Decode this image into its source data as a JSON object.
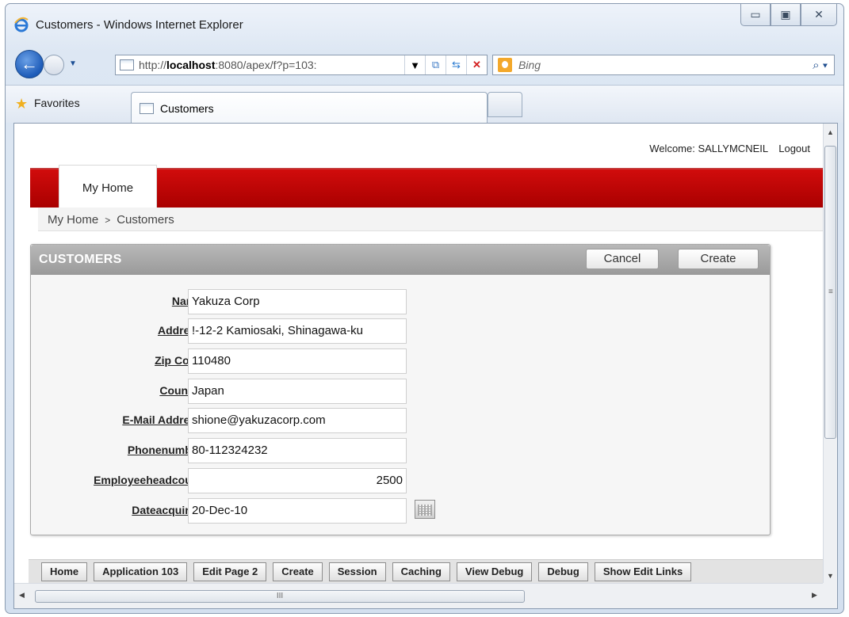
{
  "window": {
    "title": "Customers - Windows Internet Explorer",
    "controls": [
      "minimize-icon",
      "maximize-icon",
      "close-icon"
    ]
  },
  "navigation": {
    "url_prefix": "http://",
    "url_host": "localhost",
    "url_rest": ":8080/apex/f?p=103:",
    "search_placeholder": "Bing"
  },
  "favorites_bar": {
    "favorites_label": "Favorites",
    "tab_label": "Customers"
  },
  "header": {
    "welcome": "Welcome: SALLYMCNEIL",
    "logout": "Logout",
    "tab": "My Home"
  },
  "breadcrumb": {
    "items": [
      "My Home",
      "Customers"
    ],
    "separator": ">"
  },
  "region": {
    "title": "CUSTOMERS",
    "cancel_label": "Cancel",
    "create_label": "Create"
  },
  "form": {
    "fields": [
      {
        "label": "Name",
        "value": "Yakuza Corp"
      },
      {
        "label": "Address",
        "value": "!-12-2 Kamiosaki, Shinagawa-ku"
      },
      {
        "label": "Zip Code",
        "value": "110480"
      },
      {
        "label": "Country",
        "value": "Japan"
      },
      {
        "label": "E-Mail Address",
        "value": "shione@yakuzacorp.com"
      },
      {
        "label": "Phonenumber",
        "value": "80-112324232"
      },
      {
        "label": "Employeeheadcount",
        "value": "2500"
      },
      {
        "label": "Dateacquired",
        "value": "20-Dec-10"
      }
    ]
  },
  "developer_toolbar": [
    "Home",
    "Application 103",
    "Edit Page 2",
    "Create",
    "Session",
    "Caching",
    "View Debug",
    "Debug",
    "Show Edit Links"
  ],
  "scrollbar": {
    "h_grip": "III",
    "v_grip": "≡"
  },
  "colors": {
    "apex_red": "#c00000",
    "region_header": "#a8a8a8",
    "ie_chrome": "#dde7f3"
  }
}
